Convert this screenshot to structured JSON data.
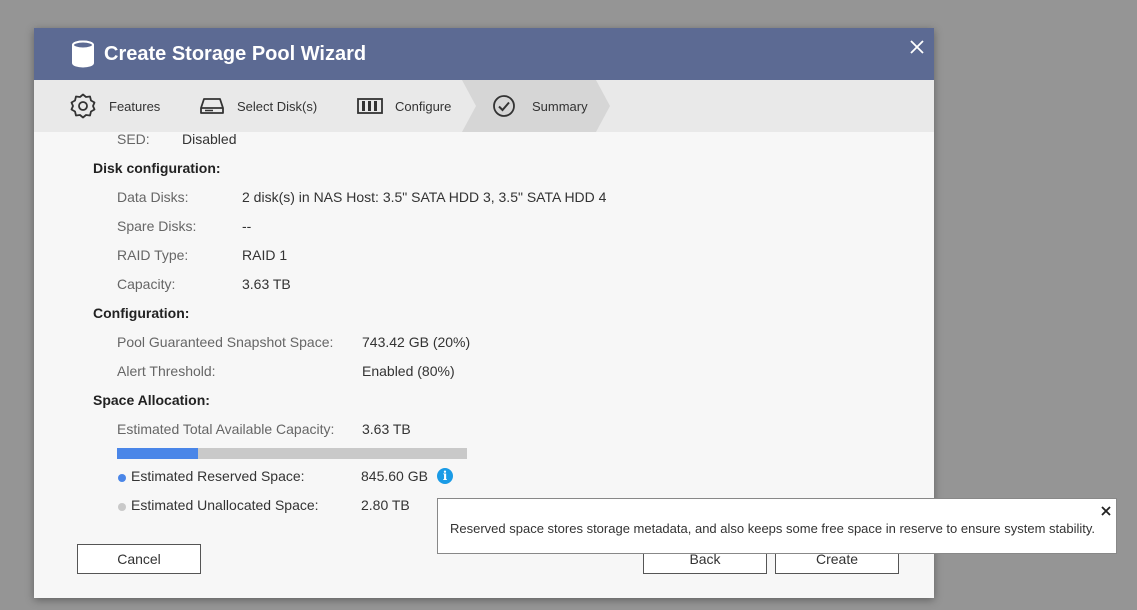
{
  "dialog": {
    "title": "Create Storage Pool Wizard",
    "icon": "database-icon"
  },
  "steps": [
    {
      "label": "Features",
      "icon": "gear-icon"
    },
    {
      "label": "Select Disk(s)",
      "icon": "disk-drive-icon"
    },
    {
      "label": "Configure",
      "icon": "raid-array-icon"
    },
    {
      "label": "Summary",
      "icon": "check-circle-icon",
      "active": true
    }
  ],
  "summary": {
    "sed": {
      "label": "SED:",
      "value": "Disabled"
    },
    "disk_config": {
      "heading": "Disk configuration:",
      "data_disks": {
        "label": "Data Disks:",
        "value": "2 disk(s) in NAS Host: 3.5\" SATA HDD 3, 3.5\" SATA HDD 4"
      },
      "spare_disks": {
        "label": "Spare Disks:",
        "value": "--"
      },
      "raid_type": {
        "label": "RAID Type:",
        "value": "RAID 1"
      },
      "capacity": {
        "label": "Capacity:",
        "value": "3.63 TB"
      }
    },
    "configuration": {
      "heading": "Configuration:",
      "snapshot_space": {
        "label": "Pool Guaranteed Snapshot Space:",
        "value": "743.42 GB (20%)"
      },
      "alert_threshold": {
        "label": "Alert Threshold:",
        "value": "Enabled (80%)"
      }
    },
    "space_allocation": {
      "heading": "Space Allocation:",
      "total": {
        "label": "Estimated Total Available Capacity:",
        "value": "3.63 TB"
      },
      "reserved": {
        "label": "Estimated Reserved Space:",
        "value": "845.60 GB"
      },
      "unallocated": {
        "label": "Estimated Unallocated Space:",
        "value": "2.80 TB"
      },
      "reserved_fraction": 0.23
    }
  },
  "buttons": {
    "cancel": "Cancel",
    "back": "Back",
    "create": "Create"
  },
  "tooltip": {
    "text": "Reserved space stores storage metadata, and also keeps some free space in reserve to ensure system stability."
  },
  "colors": {
    "titlebar": "#5c6a93",
    "reserved": "#4a86e8",
    "unallocated": "#c9c9c9",
    "info": "#1a9be6"
  }
}
